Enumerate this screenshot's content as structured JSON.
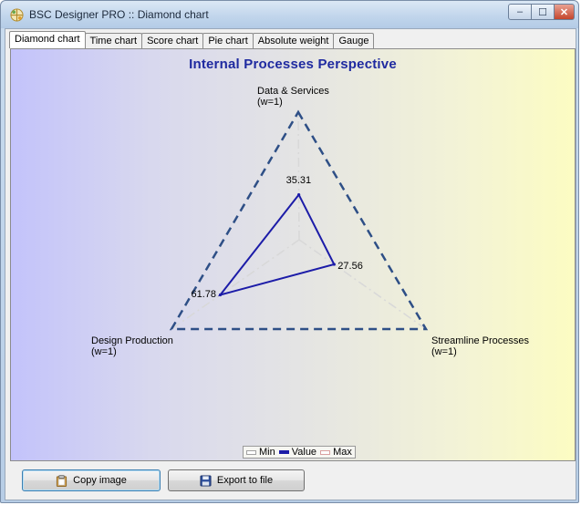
{
  "window": {
    "title": "BSC Designer PRO :: Diamond chart",
    "controls": {
      "minimize": "–",
      "maximize": "☐",
      "close": "✕"
    }
  },
  "tabs": [
    {
      "label": "Diamond chart",
      "active": true
    },
    {
      "label": "Time chart",
      "active": false
    },
    {
      "label": "Score chart",
      "active": false
    },
    {
      "label": "Pie chart",
      "active": false
    },
    {
      "label": "Absolute weight",
      "active": false
    },
    {
      "label": "Gauge",
      "active": false
    }
  ],
  "chart_data": {
    "type": "radar",
    "title": "Internal Processes Perspective",
    "axes": [
      {
        "name": "Data & Services",
        "weight": "(w=1)"
      },
      {
        "name": "Streamline Processes",
        "weight": "(w=1)"
      },
      {
        "name": "Design Production",
        "weight": "(w=1)"
      }
    ],
    "range": [
      0,
      100
    ],
    "series": [
      {
        "name": "Min",
        "values": [
          0,
          0,
          0
        ],
        "color": "#b8b8b8",
        "style": "dash-dot"
      },
      {
        "name": "Value",
        "values": [
          35.31,
          27.56,
          61.78
        ],
        "color": "#1c1ca8",
        "style": "solid"
      },
      {
        "name": "Max",
        "values": [
          100,
          100,
          100
        ],
        "color": "#2e4f86",
        "style": "dashed"
      }
    ],
    "data_labels": [
      "35.31",
      "27.56",
      "61.78"
    ],
    "legend": {
      "position": "bottom-center"
    }
  },
  "buttons": {
    "copy": "Copy image",
    "export": "Export to file"
  }
}
